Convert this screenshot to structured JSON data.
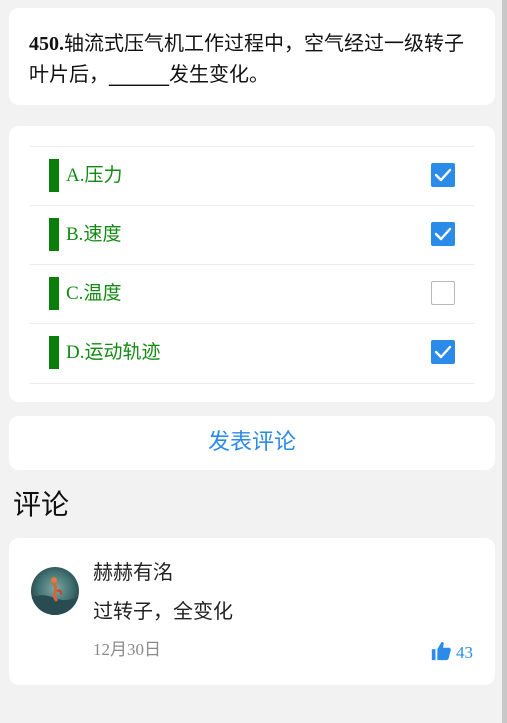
{
  "question": {
    "number": "450.",
    "text": "轴流式压气机工作过程中，空气经过一级转子叶片后，______发生变化。"
  },
  "options": [
    {
      "letter": "A.",
      "text": "压力",
      "checked": true
    },
    {
      "letter": "B.",
      "text": "速度",
      "checked": true
    },
    {
      "letter": "C.",
      "text": "温度",
      "checked": false
    },
    {
      "letter": "D.",
      "text": "运动轨迹",
      "checked": true
    }
  ],
  "colors": {
    "accent": "#2b8be8",
    "option_bar": "#0a7d0a",
    "option_text": "#138a13"
  },
  "comment_button": {
    "label": "发表评论"
  },
  "comments_section": {
    "title": "评论"
  },
  "comments": [
    {
      "user": "赫赫有洺",
      "text": "过转子，全变化",
      "date": "12月30日",
      "likes": "43",
      "avatar_icon": "avatar-image",
      "like_icon": "thumbs-up-icon"
    }
  ]
}
